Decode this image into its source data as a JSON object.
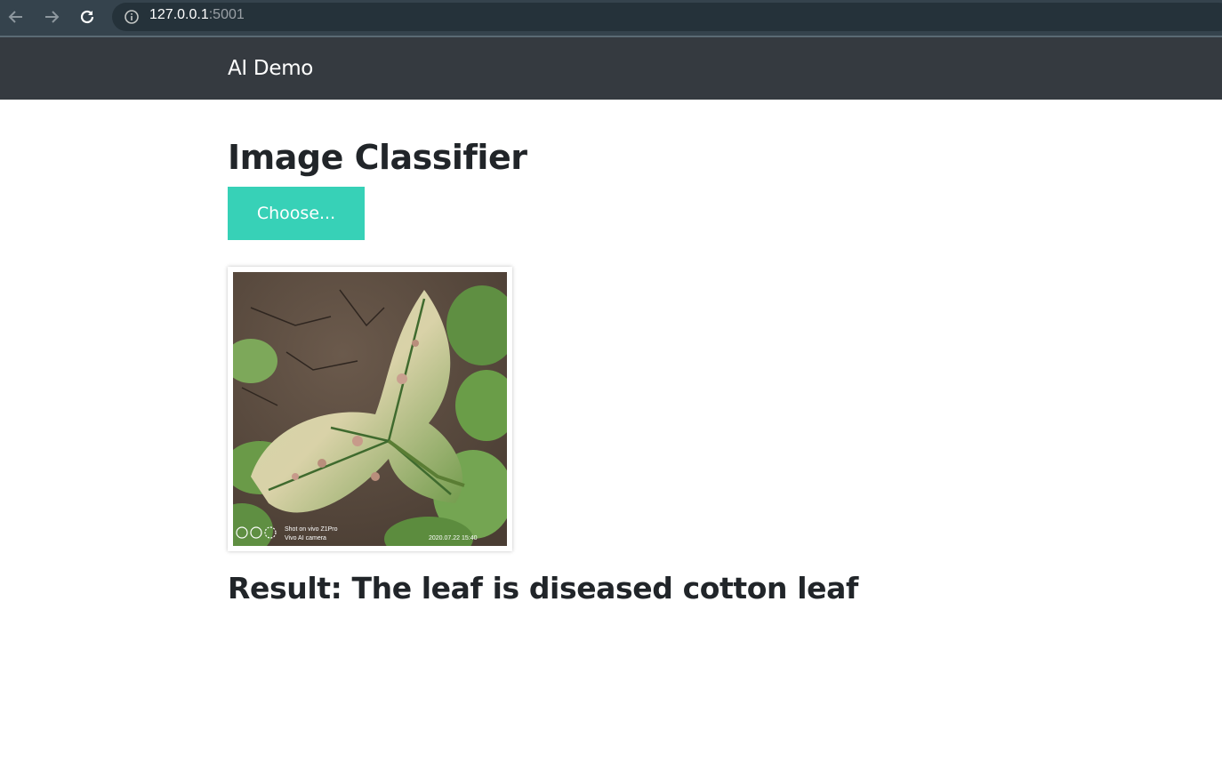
{
  "browser": {
    "url_host": "127.0.0.1",
    "url_port": ":5001",
    "icons": [
      "back-arrow-icon",
      "forward-arrow-icon",
      "reload-icon",
      "info-icon"
    ]
  },
  "navbar": {
    "brand": "AI Demo"
  },
  "main": {
    "title": "Image Classifier",
    "choose_label": "Choose...",
    "preview_overlay": {
      "line1": "Shot on vivo Z1Pro",
      "line2": "Vivo AI camera",
      "timestamp": "2020.07.22 15:40"
    },
    "result": "Result: The leaf is diseased cotton leaf"
  },
  "colors": {
    "navbar": "#353a40",
    "accent": "#37d1b7",
    "text": "#212529"
  }
}
